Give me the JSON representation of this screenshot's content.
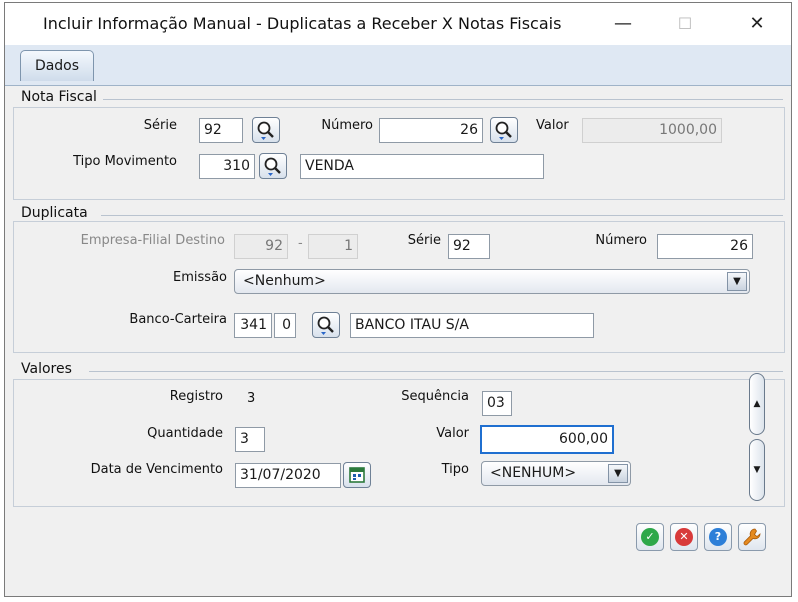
{
  "window": {
    "title": "Incluir Informação Manual - Duplicatas a Receber X Notas Fiscais",
    "controls": {
      "minimize": "—",
      "maximize": "☐",
      "close": "✕"
    }
  },
  "tabs": [
    {
      "label": "Dados",
      "active": true
    }
  ],
  "nota_fiscal": {
    "section_title": "Nota Fiscal",
    "serie_label": "Série",
    "serie_value": "92",
    "numero_label": "Número",
    "numero_value": "26",
    "valor_label": "Valor",
    "valor_value": "1000,00",
    "tipo_mov_label": "Tipo Movimento",
    "tipo_mov_code": "310",
    "tipo_mov_desc": "VENDA"
  },
  "duplicata": {
    "section_title": "Duplicata",
    "empresa_label": "Empresa-Filial Destino",
    "empresa_value": "92",
    "sep": "-",
    "filial_value": "1",
    "serie_label": "Série",
    "serie_value": "92",
    "numero_label": "Número",
    "numero_value": "26",
    "emissao_label": "Emissão",
    "emissao_value": "<Nenhum>",
    "banco_label": "Banco-Carteira",
    "banco_code": "341",
    "carteira_code": "0",
    "banco_desc": "BANCO ITAU S/A"
  },
  "valores": {
    "section_title": "Valores",
    "registro_label": "Registro",
    "registro_value": "3",
    "sequencia_label": "Sequência",
    "sequencia_value": "03",
    "quantidade_label": "Quantidade",
    "quantidade_value": "3",
    "valor_label": "Valor",
    "valor_value": "600,00",
    "vencimento_label": "Data de Vencimento",
    "vencimento_value": "31/07/2020",
    "tipo_label": "Tipo",
    "tipo_value": "<NENHUM>"
  },
  "actions": {
    "confirm_icon": "check-icon",
    "cancel_icon": "x-icon",
    "help_icon": "question-icon",
    "tools_icon": "wrench-icon"
  },
  "colors": {
    "confirm": "#2ea84a",
    "cancel": "#d83a3a",
    "help": "#2d7fd8",
    "tools": "#e58a1f"
  }
}
